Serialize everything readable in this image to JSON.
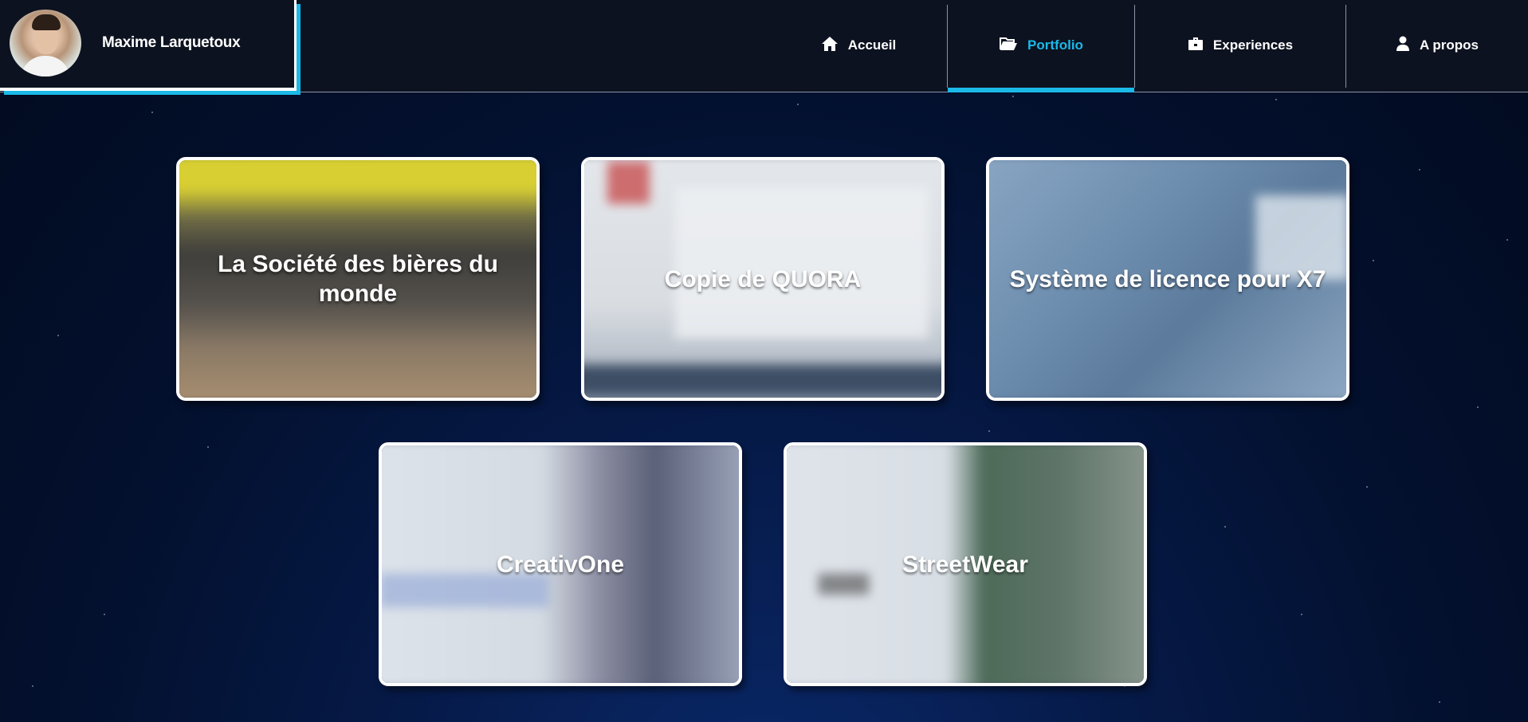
{
  "profile": {
    "name": "Maxime Larquetoux"
  },
  "nav": {
    "items": [
      {
        "label": "Accueil",
        "icon": "home-icon"
      },
      {
        "label": "Portfolio",
        "icon": "folder-open-icon",
        "active": true
      },
      {
        "label": "Experiences",
        "icon": "briefcase-icon"
      },
      {
        "label": "A propos",
        "icon": "user-icon"
      }
    ]
  },
  "colors": {
    "accent": "#1bb9e8",
    "header_bg": "#0d1220",
    "card_border": "#ffffff"
  },
  "projects": [
    {
      "title": "La Société des bières du monde"
    },
    {
      "title": "Copie de QUORA"
    },
    {
      "title": "Système de licence pour X7"
    },
    {
      "title": "CreativOne"
    },
    {
      "title": "StreetWear"
    }
  ]
}
